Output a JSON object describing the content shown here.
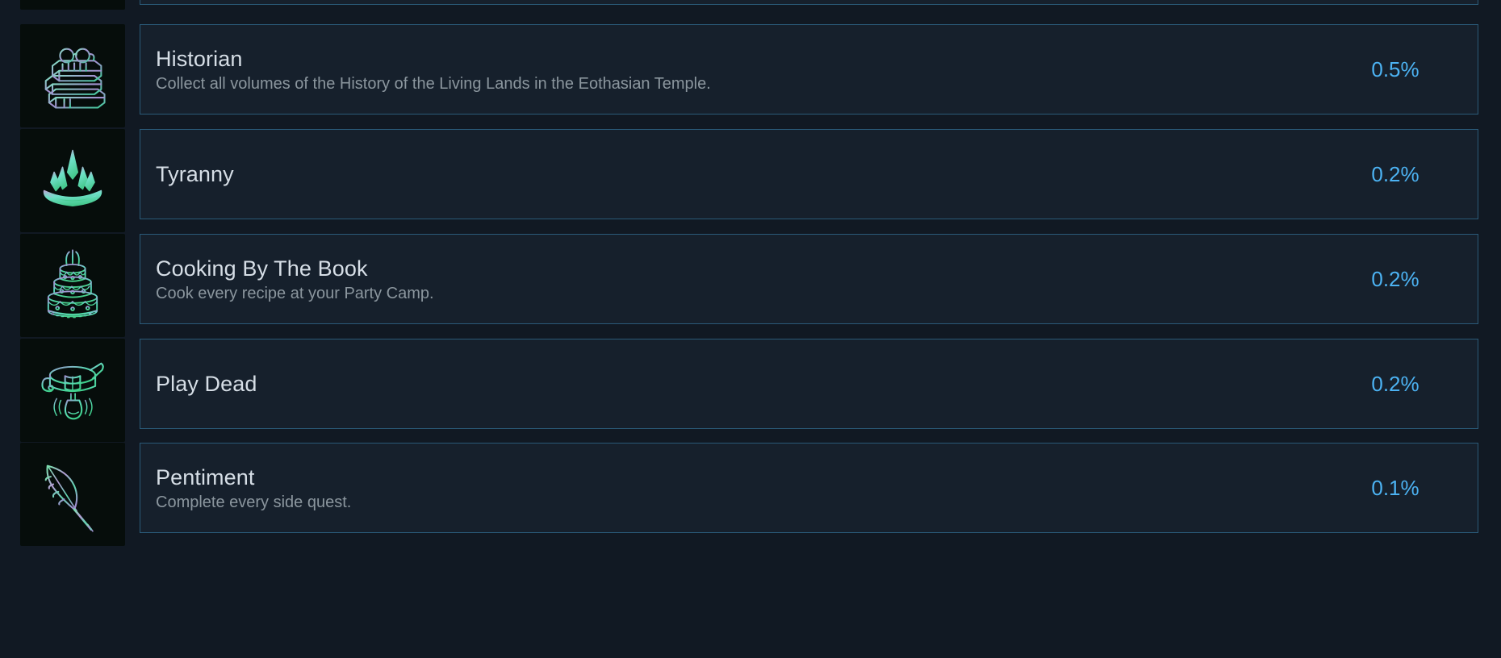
{
  "theme": {
    "page_background": "#111923",
    "row_background": "#16202c",
    "row_border": "#2a5a78",
    "icon_background": "#060d0b",
    "title_color": "#d6dee6",
    "description_color": "#8b969e",
    "percent_color": "#4cb2f2"
  },
  "achievements": [
    {
      "icon": "books-with-glasses-icon",
      "title": "Historian",
      "description": "Collect all volumes of the History of the Living Lands in the Eothasian Temple.",
      "percent": "0.5%"
    },
    {
      "icon": "crown-icon",
      "title": "Tyranny",
      "description": "",
      "percent": "0.2%"
    },
    {
      "icon": "tiered-cake-icon",
      "title": "Cooking By The Book",
      "description": "Cook every recipe at your Party Camp.",
      "percent": "0.2%"
    },
    {
      "icon": "collar-with-bell-icon",
      "title": "Play Dead",
      "description": "",
      "percent": "0.2%"
    },
    {
      "icon": "quill-feather-icon",
      "title": "Pentiment",
      "description": "Complete every side quest.",
      "percent": "0.1%"
    }
  ]
}
